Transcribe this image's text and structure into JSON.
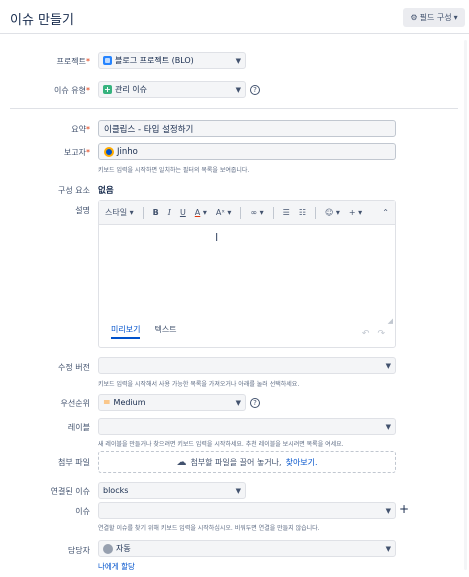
{
  "dialog": {
    "title": "이슈 만들기",
    "config_button": "필드 구성",
    "config_icon": "gear-icon"
  },
  "fields": {
    "project": {
      "label": "프로젝트",
      "value": "블로그 프로젝트 (BLO)"
    },
    "issue_type": {
      "label": "이슈 유형",
      "value": "관리 이슈"
    },
    "summary": {
      "label": "요약",
      "value": "이클립스 -  타입 설정하기"
    },
    "reporter": {
      "label": "보고자",
      "value": "Jinho",
      "help": "키보드 입력을 시작하면 일치하는 필터의 목록을 보여줍니다."
    },
    "component": {
      "label": "구성 요소",
      "value": "없음"
    },
    "description": {
      "label": "설명",
      "toolbar": {
        "style": "스타일",
        "bold": "B",
        "italic": "I",
        "underline": "U",
        "color": "A",
        "more_format": "A",
        "link": "∞",
        "bullet": "☰",
        "numbered": "☷",
        "emoji": "☺",
        "insert": "+"
      },
      "tab_preview": "미리보기",
      "tab_text": "텍스트"
    },
    "fix_version": {
      "label": "수정 버전",
      "value": "",
      "help": "키보드 입력을 시작해서 사용 가능한 목록을 가져오거나 아래를 눌러 선택하세요."
    },
    "priority": {
      "label": "우선순위",
      "value": "Medium"
    },
    "labels": {
      "label": "레이블",
      "value": "",
      "help": "새 레이블을 만들거나 찾으려면 키보드 입력을 시작하세요. 추천 레이블을 보시려면 목록을 여세요."
    },
    "attachment": {
      "label": "첨부 파일",
      "text": "첨부할 파일을 끌어 놓거나,",
      "link": "찾아보기."
    },
    "linked_issue": {
      "label": "연결된 이슈",
      "value": "blocks"
    },
    "issue": {
      "label": "이슈",
      "value": "",
      "help": "연결할 이슈를 찾기 위해 키보드 입력을 시작하십시오. 비워두면 연결을 만들지 않습니다."
    },
    "assignee": {
      "label": "담당자",
      "value": "자동",
      "assign_me": "나에게 할당"
    }
  },
  "colors": {
    "accent": "#0052cc",
    "required": "#de350b",
    "field_bg": "#f4f5f7"
  }
}
